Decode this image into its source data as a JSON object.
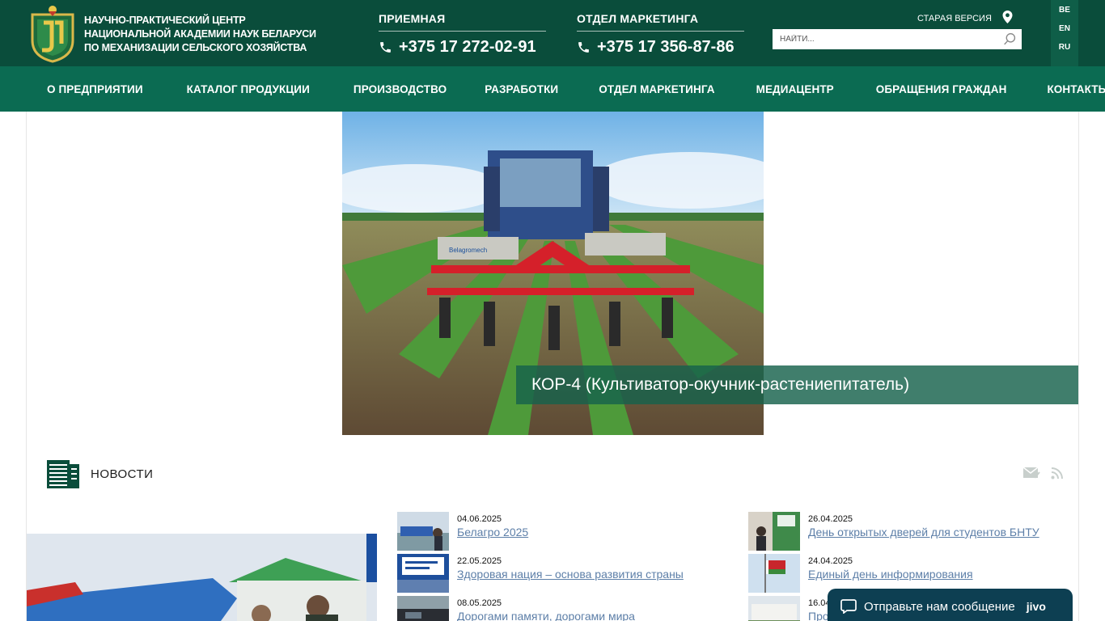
{
  "header": {
    "org_name_lines": [
      "НАУЧНО-ПРАКТИЧЕСКИЙ ЦЕНТР",
      "НАЦИОНАЛЬНОЙ АКАДЕМИИ НАУК БЕЛАРУСИ",
      "ПО МЕХАНИЗАЦИИ СЕЛЬСКОГО ХОЗЯЙСТВА"
    ],
    "reception": {
      "title": "ПРИЕМНАЯ",
      "phone": "+375 17 272-02-91"
    },
    "marketing": {
      "title": "ОТДЕЛ МАРКЕТИНГА",
      "phone": "+375 17 356-87-86"
    },
    "old_version": "СТАРАЯ ВЕРСИЯ",
    "search_placeholder": "НАЙТИ...",
    "languages": [
      "BE",
      "EN",
      "RU"
    ]
  },
  "nav": {
    "items": [
      "О ПРЕДПРИЯТИИ",
      "КАТАЛОГ ПРОДУКЦИИ",
      "ПРОИЗВОДСТВО",
      "РАЗРАБОТКИ",
      "ОТДЕЛ МАРКЕТИНГА",
      "МЕДИАЦЕНТР",
      "ОБРАЩЕНИЯ ГРАЖДАН",
      "КОНТАКТЫ"
    ]
  },
  "hero": {
    "caption": "КОР-4 (Культиватор-окучник-растениепитатель)",
    "brand_plate": "Belagromech"
  },
  "news": {
    "title": "НОВОСТИ",
    "items": [
      {
        "date": "04.06.2025",
        "title": "Белагро 2025"
      },
      {
        "date": "22.05.2025",
        "title": "Здоровая нация – основа развития страны"
      },
      {
        "date": "08.05.2025",
        "title": "Дорогами памяти, дорогами мира"
      },
      {
        "date": "26.04.2025",
        "title": "День открытых дверей для студентов БНТУ"
      },
      {
        "date": "24.04.2025",
        "title": "Единый день информирования"
      },
      {
        "date": "16.04",
        "title": "Про"
      }
    ]
  },
  "chat_widget": {
    "text": "Отправьте нам сообщение",
    "brand": "jivo"
  },
  "colors": {
    "header_bg": "#0a4d3b",
    "nav_bg": "#0b6b52",
    "accent": "#16624c",
    "link": "#5d7fa8",
    "chat_bg": "#0d3f52"
  }
}
